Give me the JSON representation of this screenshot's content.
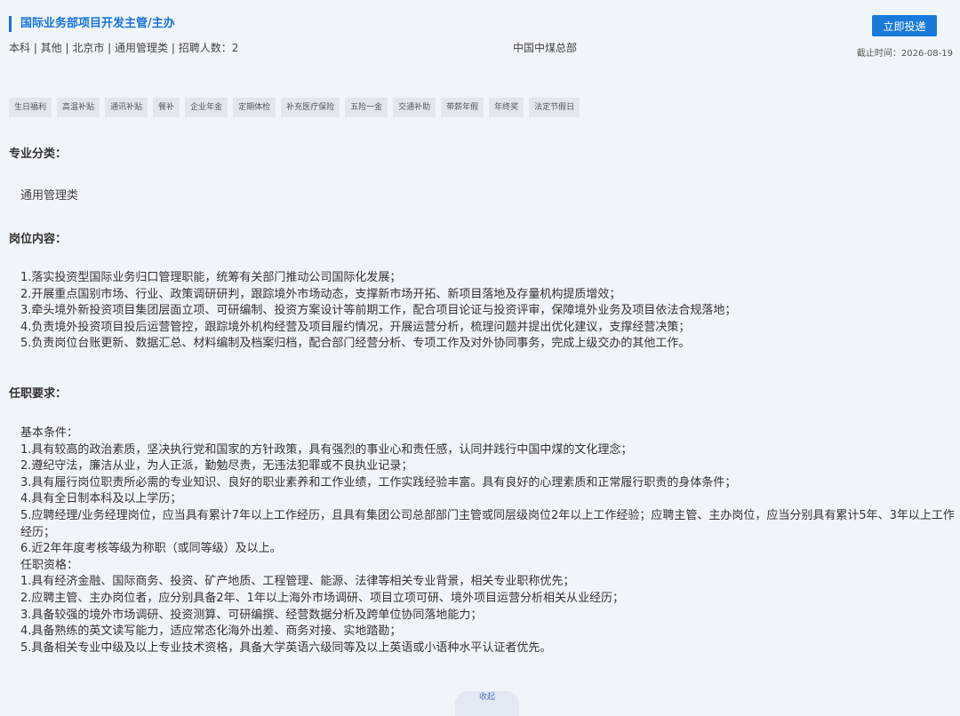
{
  "job": {
    "title": "国际业务部项目开发主管/主办",
    "meta": "本科 | 其他 | 北京市 |  通用管理类  |  招聘人数：2",
    "company": "中国中煤总部",
    "apply_label": "立即投递",
    "deadline": "截止时间：2026-08-19"
  },
  "tags": [
    "生日福利",
    "高温补贴",
    "通讯补贴",
    "餐补",
    "企业年金",
    "定期体检",
    "补充医疗保险",
    "五险一金",
    "交通补助",
    "带薪年假",
    "年终奖",
    "法定节假日"
  ],
  "major": {
    "heading": "专业分类：",
    "value": "通用管理类"
  },
  "duties": {
    "heading": "岗位内容：",
    "lines": [
      "1.落实投资型国际业务归口管理职能，统筹有关部门推动公司国际化发展；",
      "2.开展重点国别市场、行业、政策调研研判，跟踪境外市场动态，支撑新市场开拓、新项目落地及存量机构提质增效；",
      "3.牵头境外新投资项目集团层面立项、可研编制、投资方案设计等前期工作，配合项目论证与投资评审，保障境外业务及项目依法合规落地；",
      "4.负责境外投资项目投后运营管控，跟踪境外机构经营及项目履约情况，开展运营分析，梳理问题并提出优化建议，支撑经营决策；",
      "5.负责岗位台账更新、数据汇总、材料编制及档案归档，配合部门经营分析、专项工作及对外协同事务，完成上级交办的其他工作。"
    ]
  },
  "requirements": {
    "heading": "任职要求：",
    "lines": [
      "基本条件：",
      "1.具有较高的政治素质，坚决执行党和国家的方针政策，具有强烈的事业心和责任感，认同并践行中国中煤的文化理念；",
      "2.遵纪守法，廉洁从业，为人正派，勤勉尽责，无违法犯罪或不良执业记录；",
      "3.具有履行岗位职责所必需的专业知识、良好的职业素养和工作业绩，工作实践经验丰富。具有良好的心理素质和正常履行职责的身体条件；",
      "4.具有全日制本科及以上学历；",
      "5.应聘经理/业务经理岗位，应当具有累计7年以上工作经历，且具有集团公司总部部门主管或同层级岗位2年以上工作经验；应聘主管、主办岗位，应当分别具有累计5年、3年以上工作经历；",
      "6.近2年年度考核等级为称职（或同等级）及以上。",
      "任职资格：",
      "1.具有经济金融、国际商务、投资、矿产地质、工程管理、能源、法律等相关专业背景，相关专业职称优先；",
      "2.应聘主管、主办岗位者，应分别具备2年、1年以上海外市场调研、项目立项可研、境外项目运营分析相关从业经历；",
      "3.具备较强的境外市场调研、投资测算、可研编撰、经营数据分析及跨单位协同落地能力；",
      "4.具备熟练的英文读写能力，适应常态化海外出差、商务对接、实地踏勘；",
      "5.具备相关专业中级及以上专业技术资格，具备大学英语六级同等及以上英语或小语种水平认证者优先。"
    ]
  },
  "collapse_label": "收起"
}
